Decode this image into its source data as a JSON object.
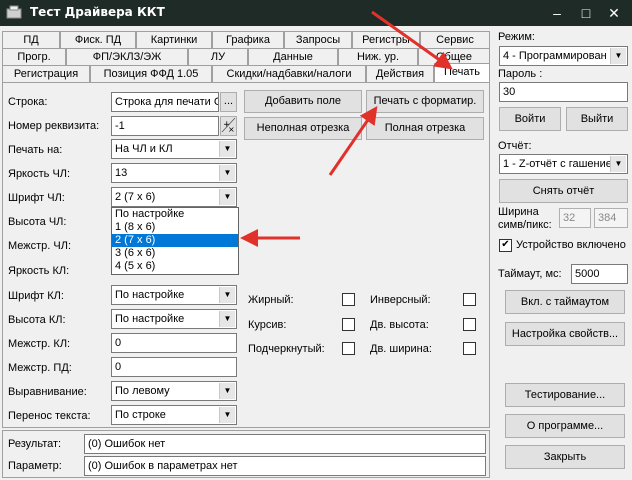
{
  "window": {
    "title": "Тест Драйвера ККТ",
    "min": "–",
    "max": "□",
    "close": "✕"
  },
  "tabs": {
    "row1": [
      "ПД",
      "Фиск. ПД",
      "Картинки",
      "Графика",
      "Запросы",
      "Регистры",
      "Сервис"
    ],
    "row2": [
      "Прогр.",
      "ФП/ЭКЛЗ/ЭЖ",
      "ЛУ",
      "Данные",
      "Ниж. ур.",
      "Общее"
    ],
    "row3": [
      "Регистрация",
      "Позиция ФФД 1.05",
      "Скидки/надбавки/налоги",
      "Действия",
      "Печать"
    ]
  },
  "form": {
    "string_label": "Строка:",
    "string_value": "Строка для печати С",
    "string_btn": "...",
    "req_label": "Номер реквизита:",
    "req_value": "-1",
    "print_on_label": "Печать на:",
    "print_on_value": "На ЧЛ и КЛ",
    "bright_cl_label": "Яркость ЧЛ:",
    "bright_cl_value": "13",
    "font_cl_label": "Шрифт ЧЛ:",
    "font_cl_value": "2 (7 x 6)",
    "height_cl_label": "Высота ЧЛ:",
    "spacing_cl_label": "Межстр. ЧЛ:",
    "bright_kl_label": "Яркость КЛ:",
    "font_kl_label": "Шрифт КЛ:",
    "font_kl_value": "По настройке",
    "height_kl_label": "Высота КЛ:",
    "height_kl_value": "По настройке",
    "spacing_kl_label": "Межстр. КЛ:",
    "spacing_kl_value": "0",
    "spacing_pd_label": "Межстр. ПД:",
    "spacing_pd_value": "0",
    "align_label": "Выравнивание:",
    "align_value": "По левому",
    "wrap_label": "Перенос текста:",
    "wrap_value": "По строке"
  },
  "dropdown": [
    "По настройке",
    "1 (8 x 6)",
    "2 (7 x 6)",
    "3 (6 x 6)",
    "4 (5 x 6)"
  ],
  "dropdown_selected": 2,
  "buttons": {
    "add_field": "Добавить поле",
    "print_fmt": "Печать с форматир.",
    "partial_cut": "Неполная отрезка",
    "full_cut": "Полная отрезка"
  },
  "checks": {
    "bold": "Жирный:",
    "inverse": "Инверсный:",
    "italic": "Курсив:",
    "dbl_height": "Дв. высота:",
    "underline": "Подчеркнутый:",
    "dbl_width": "Дв. ширина:"
  },
  "result_label": "Результат:",
  "result_value": "(0) Ошибок нет",
  "param_label": "Параметр:",
  "param_value": "(0) Ошибок в параметрах нет",
  "side": {
    "mode_label": "Режим:",
    "mode_value": "4 - Программирован",
    "password_label": "Пароль :",
    "password_value": "30",
    "login": "Войти",
    "logout": "Выйти",
    "report_label": "Отчёт:",
    "report_value": "1 - Z-отчёт с гашение",
    "take_report": "Снять отчёт",
    "width_label_1": "Ширина",
    "width_label_2": "симв/пикс:",
    "width_chars": "32",
    "width_pix": "384",
    "device_enabled": "Устройство включено",
    "device_check": "✔",
    "timeout_label": "Таймаут, мс:",
    "timeout_value": "5000",
    "enable_timeout": "Вкл. с таймаутом",
    "props": "Настройка свойств...",
    "testing": "Тестирование...",
    "about": "О программе...",
    "close": "Закрыть"
  },
  "colors": {
    "annotation_arrow": "#e0312b",
    "selection": "#0078d7",
    "titlebar": "#1f2b26"
  }
}
